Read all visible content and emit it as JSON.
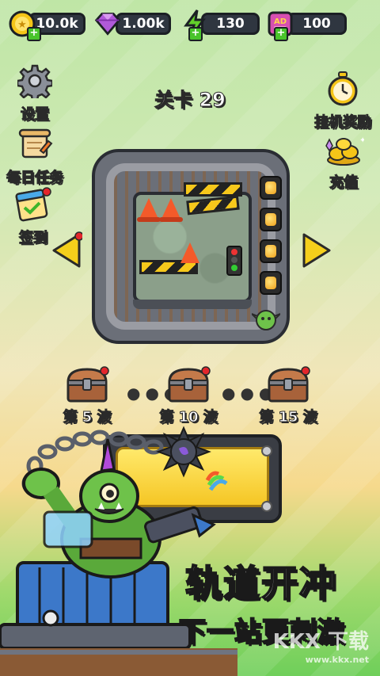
{
  "resources": [
    {
      "name": "coins",
      "value": "10.0k",
      "icon": "gold-coin-icon",
      "color": "#f5c518"
    },
    {
      "name": "gems",
      "value": "1.00k",
      "icon": "purple-gem-icon",
      "color": "#b05ad9"
    },
    {
      "name": "energy",
      "value": "130",
      "icon": "lightning-icon",
      "color": "#62d02b"
    },
    {
      "name": "ad-tickets",
      "value": "100",
      "icon": "ad-ticket-icon",
      "color": "#d64fb0"
    }
  ],
  "left_menu": {
    "settings": "设置",
    "daily_tasks": "每日任务",
    "checkin": "签到"
  },
  "right_menu": {
    "idle_rewards": "挂机奖励",
    "recharge": "充值"
  },
  "level": {
    "title": "关卡 29"
  },
  "waves": [
    {
      "label": "第 5 波"
    },
    {
      "label": "第 10 波"
    },
    {
      "label": "第 15 波"
    }
  ],
  "promo": {
    "headline": "轨道开冲",
    "subline": "下一站更刺激"
  },
  "watermark": {
    "text": "KKX 下载",
    "url": "www.kkx.net"
  }
}
